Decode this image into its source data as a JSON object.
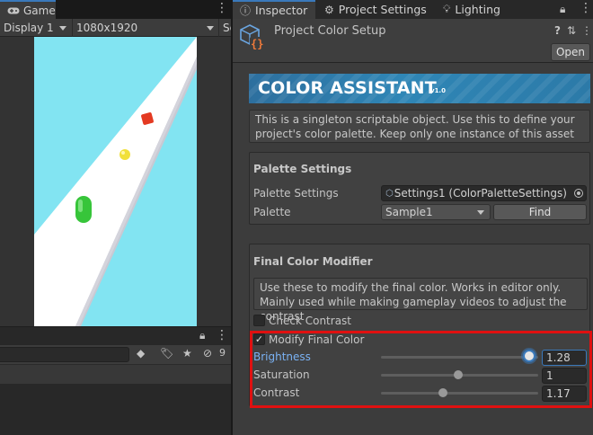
{
  "game": {
    "tab_label": "Game",
    "display_dropdown": "Display 1",
    "resolution_dropdown": "1080x1920",
    "next_dropdown_fragment": "Se",
    "bottom_counter": "9"
  },
  "inspector_tabs": [
    {
      "label": "Inspector",
      "icon": "info-icon"
    },
    {
      "label": "Project Settings",
      "icon": "gear-icon"
    },
    {
      "label": "Lighting",
      "icon": "lightbulb-icon"
    }
  ],
  "header": {
    "title": "Project Color Setup",
    "open_button": "Open",
    "help_icon": "?"
  },
  "banner": {
    "title": "COLOR ASSISTANT",
    "version": "v1.0"
  },
  "description": "This is a singleton scriptable object. Use this to define your project's color palette. Keep only one instance of this asset",
  "palette_settings": {
    "section_title": "Palette Settings",
    "field_label": "Palette Settings",
    "field_value": "Settings1 (ColorPaletteSettings)",
    "palette_label": "Palette",
    "palette_value": "Sample1",
    "find_button": "Find"
  },
  "final_color_modifier": {
    "section_title": "Final Color Modifier",
    "help_text": "Use these to modify the final color. Works in editor only. Mainly used while making gameplay videos to adjust the contrast",
    "check_contrast": {
      "label": "Check Contrast",
      "checked": false
    },
    "modify_final_color": {
      "label": "Modify Final Color",
      "checked": true
    },
    "sliders": [
      {
        "label": "Brightness",
        "value": "1.28",
        "position": 0.98
      },
      {
        "label": "Saturation",
        "value": "1",
        "position": 0.49
      },
      {
        "label": "Contrast",
        "value": "1.17",
        "position": 0.39
      }
    ]
  },
  "colors": {
    "accent": "#3a79bb",
    "highlight": "#e01010",
    "sky": "#82e4f2",
    "green_player": "#37c53a",
    "yellow_coin": "#f1e03a",
    "red_obstacle": "#e43a22"
  }
}
